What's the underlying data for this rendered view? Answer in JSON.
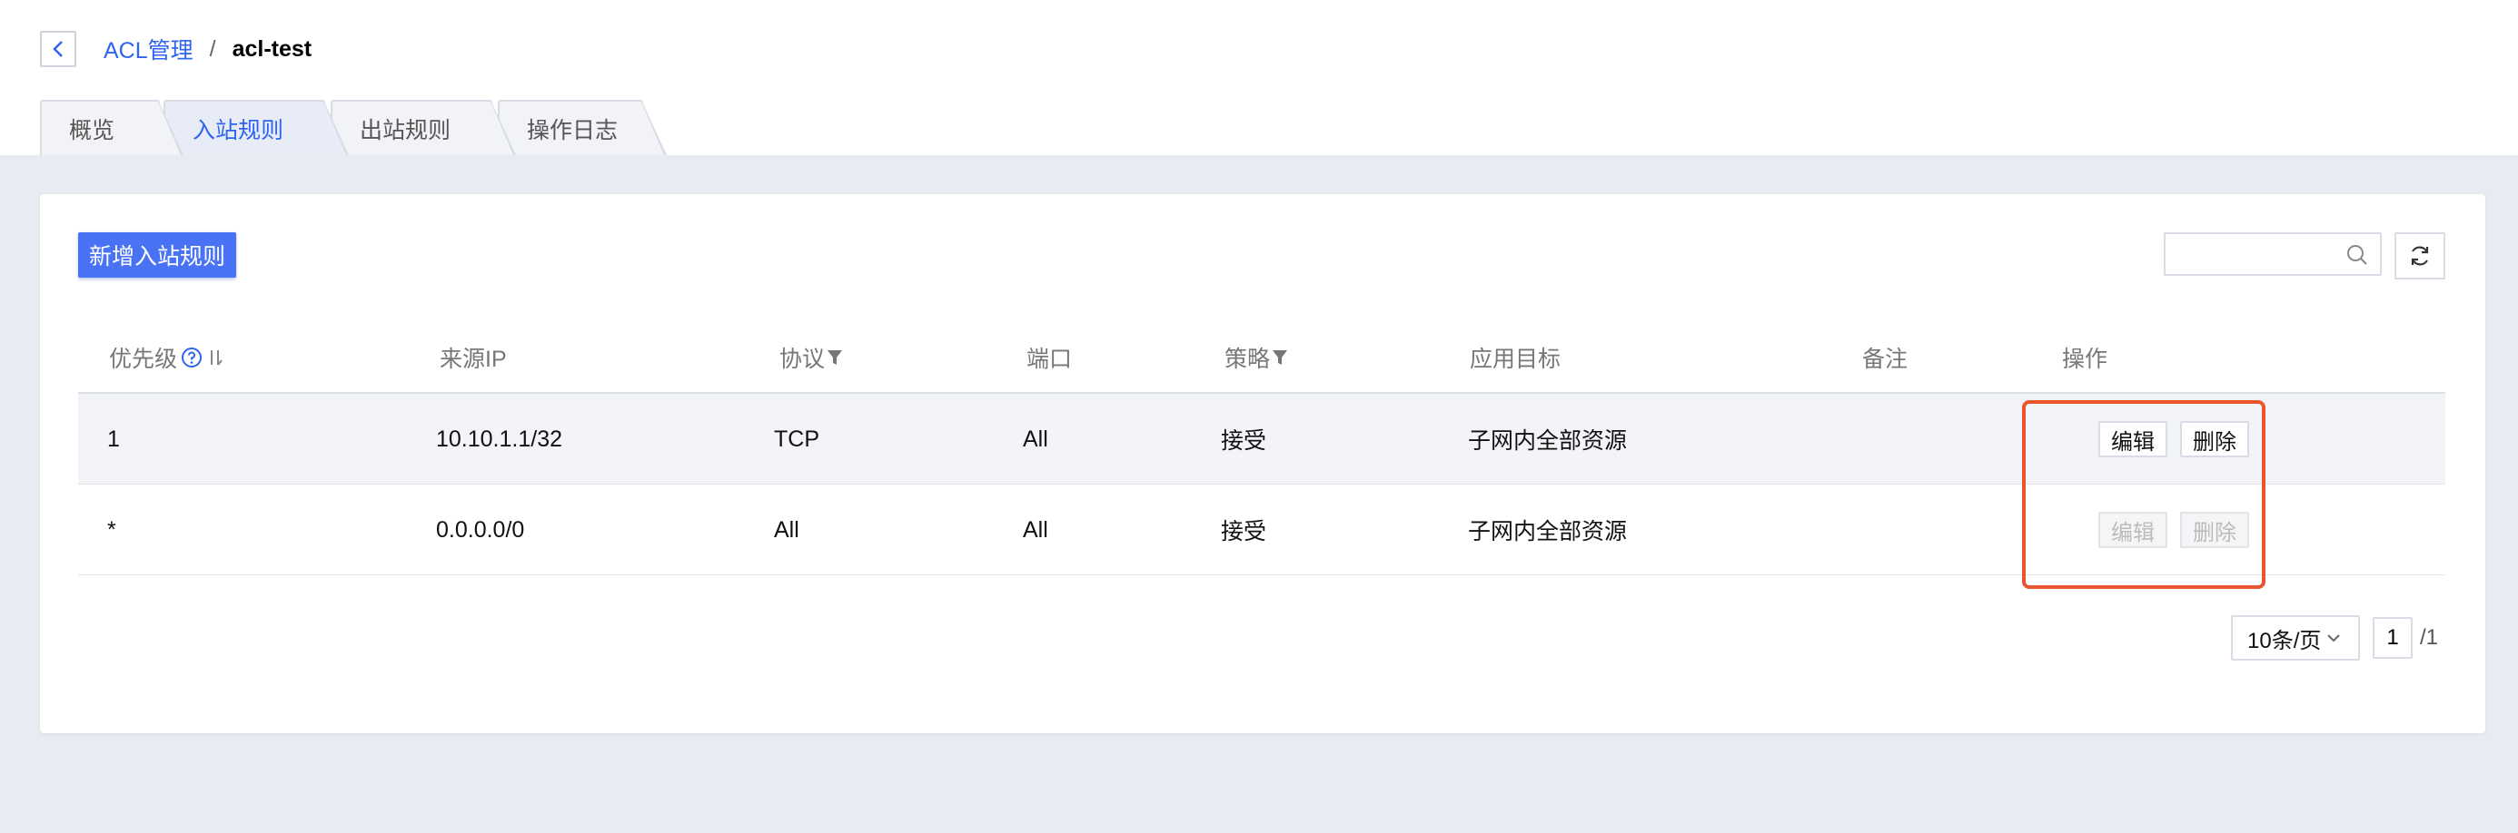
{
  "breadcrumb": {
    "parent": "ACL管理",
    "separator": "/",
    "current": "acl-test"
  },
  "tabs": [
    {
      "label": "概览",
      "active": false
    },
    {
      "label": "入站规则",
      "active": true
    },
    {
      "label": "出站规则",
      "active": false
    },
    {
      "label": "操作日志",
      "active": false
    }
  ],
  "toolbar": {
    "add_label": "新增入站规则",
    "search_value": ""
  },
  "table": {
    "headers": {
      "priority": "优先级",
      "source_ip": "来源IP",
      "protocol": "协议",
      "port": "端口",
      "policy": "策略",
      "target": "应用目标",
      "remark": "备注",
      "actions": "操作"
    },
    "rows": [
      {
        "priority": "1",
        "source_ip": "10.10.1.1/32",
        "protocol": "TCP",
        "port": "All",
        "policy": "接受",
        "target": "子网内全部资源",
        "remark": "",
        "edit": "编辑",
        "delete": "删除",
        "actions_enabled": true
      },
      {
        "priority": "*",
        "source_ip": "0.0.0.0/0",
        "protocol": "All",
        "port": "All",
        "policy": "接受",
        "target": "子网内全部资源",
        "remark": "",
        "edit": "编辑",
        "delete": "删除",
        "actions_enabled": false
      }
    ]
  },
  "pagination": {
    "page_size": "10条/页",
    "current_page": "1",
    "total_pages": "/1"
  },
  "colors": {
    "accent": "#2f64f0",
    "primary_button": "#4a72f5",
    "highlight": "#e8552e",
    "page_bg": "#e9ebf2"
  }
}
